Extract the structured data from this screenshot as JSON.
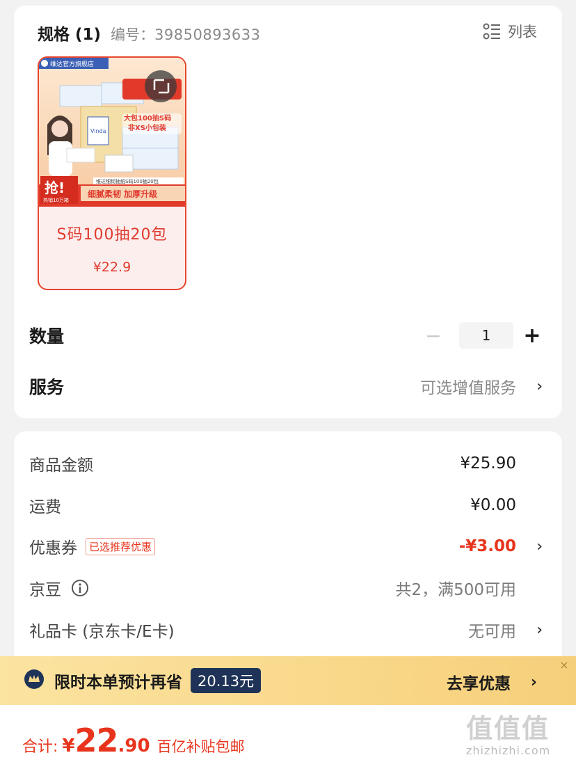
{
  "spec": {
    "title": "规格 (1)",
    "code_label": "编号：",
    "code_value": "39850893633",
    "view_toggle": "列表",
    "sku": {
      "name": "S码100抽20包",
      "price": "¥22.9",
      "image_texts": {
        "store": "维达官方旗舰店",
        "promo_big": "大包100抽S码",
        "promo_small": "非XS小包装",
        "grab": "抢!",
        "sold": "热销10万箱",
        "caption": "维达细韧抽纸S码100抽20包",
        "slogan": "细腻柔韧 加厚升级"
      }
    }
  },
  "quantity": {
    "label": "数量",
    "minus": "−",
    "value": "1",
    "plus": "+"
  },
  "service": {
    "label": "服务",
    "value": "可选增值服务"
  },
  "price": {
    "goods_label": "商品金额",
    "goods_value": "¥25.90",
    "shipping_label": "运费",
    "shipping_value": "¥0.00",
    "coupon_label": "优惠券",
    "coupon_tag": "已选推荐优惠",
    "coupon_value": "-¥3.00",
    "beans_label": "京豆",
    "beans_value": "共2，满500可用",
    "giftcard_label": "礼品卡 (京东卡/E卡)",
    "giftcard_value": "无可用"
  },
  "promo": {
    "text": "限时本单预计再省",
    "amount": "20.13元",
    "cta": "去享优惠",
    "close": "×"
  },
  "total": {
    "label": "合计:",
    "symbol": "¥",
    "integer": "22",
    "decimal": ".90",
    "note": "百亿补贴包邮"
  },
  "watermark": {
    "logo": "值值值",
    "url": "zhizhizhi.com"
  },
  "chevron": "›",
  "colors": {
    "accent_red": "#e8341c",
    "promo_bg": "#f9d88a",
    "promo_badge": "#1e3357"
  }
}
